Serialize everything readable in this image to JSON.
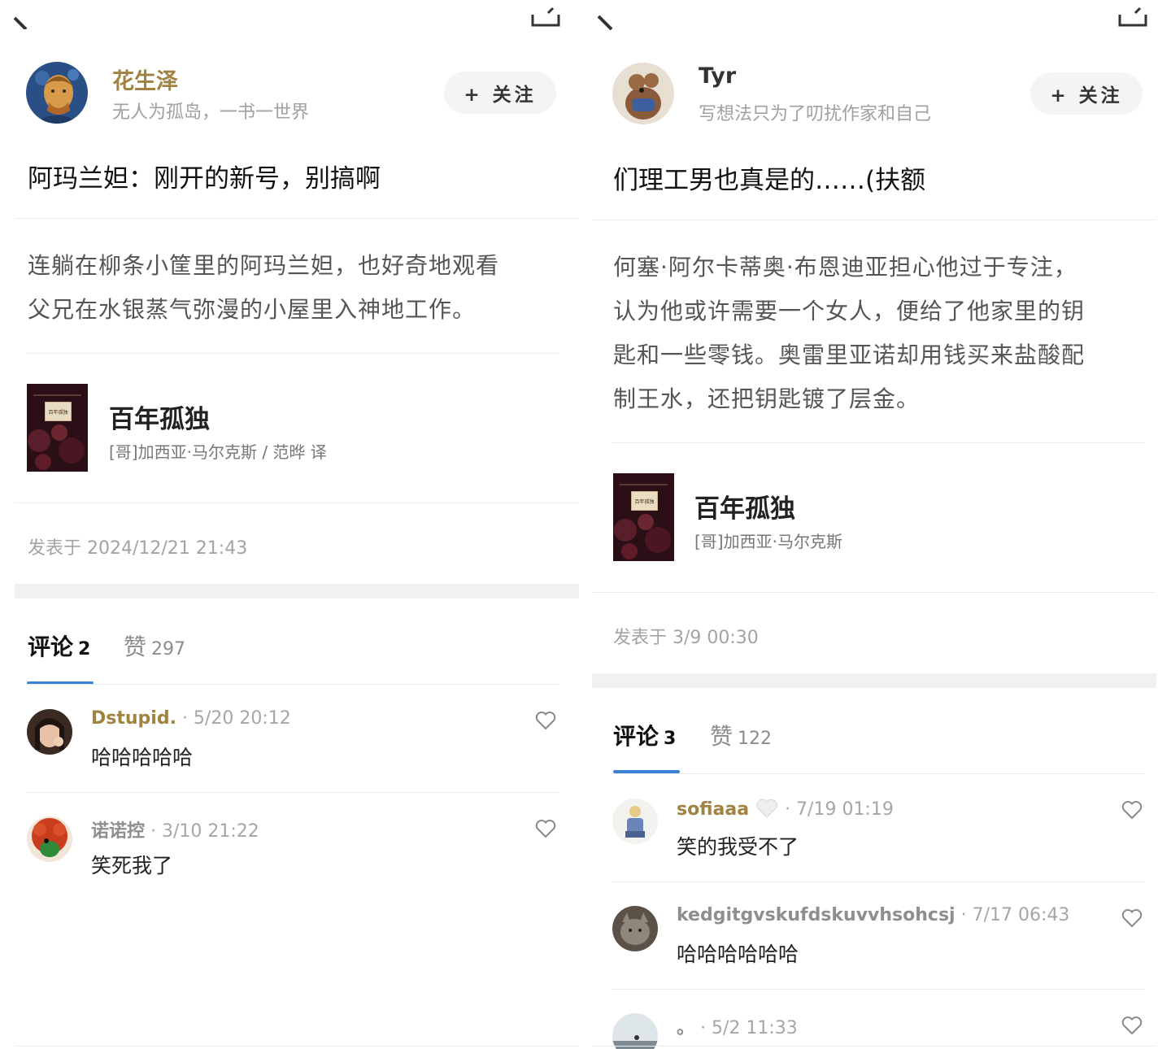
{
  "left": {
    "author": {
      "name": "花生泽",
      "bio": "无人为孤岛，一书一世界",
      "avatar": "avatar-painting-portrait"
    },
    "follow_label": "+ 关注",
    "title": "阿玛兰妲：刚开的新号，别搞啊",
    "body_lines": [
      "连躺在柳条小筐里的阿玛兰妲，也好奇地观看",
      "父兄在水银蒸气弥漫的小屋里入神地工作。"
    ],
    "book": {
      "title": "百年孤独",
      "author": "[哥]加西亚·马尔克斯 / 范晔 译",
      "cover_label": "百年孤独"
    },
    "posted": "发表于 2024/12/21 21:43",
    "tabs": [
      {
        "label": "评论",
        "count": "2"
      },
      {
        "label": "赞",
        "count": "297"
      }
    ],
    "comments": [
      {
        "name": "Dstupid.",
        "time": "· 5/20 20:12",
        "text": "哈哈哈哈哈"
      },
      {
        "name": "诺诺控",
        "time": "· 3/10 21:22",
        "text": "笑死我了"
      }
    ]
  },
  "right": {
    "author": {
      "name": "Tyr",
      "bio": "写想法只为了叨扰作家和自己",
      "avatar": "avatar-plush-toy"
    },
    "follow_label": "+ 关注",
    "title": "们理工男也真是的……(扶额",
    "body_lines": [
      "何塞·阿尔卡蒂奥·布恩迪亚担心他过于专注，",
      "认为他或许需要一个女人，便给了他家里的钥",
      "匙和一些零钱。奥雷里亚诺却用钱买来盐酸配",
      "制王水，还把钥匙镀了层金。"
    ],
    "book": {
      "title": "百年孤独",
      "author": "[哥]加西亚·马尔克斯",
      "cover_label": "百年孤独"
    },
    "posted": "发表于 3/9 00:30",
    "tabs": [
      {
        "label": "评论",
        "count": "3"
      },
      {
        "label": "赞",
        "count": "122"
      }
    ],
    "comments": [
      {
        "name": "sofiaaa",
        "time": "· 7/19 01:19",
        "text": "笑的我受不了"
      },
      {
        "name": "kedgitgvskufdskuvvhsohcsj",
        "time": "· 7/17 06:43",
        "text": "哈哈哈哈哈哈"
      },
      {
        "name": "。",
        "time": "· 5/2 11:33",
        "text": ""
      }
    ]
  },
  "colors": {
    "accent_name": "#a08241",
    "tab_underline": "#3a82d6",
    "band": "#f0f1f3"
  }
}
